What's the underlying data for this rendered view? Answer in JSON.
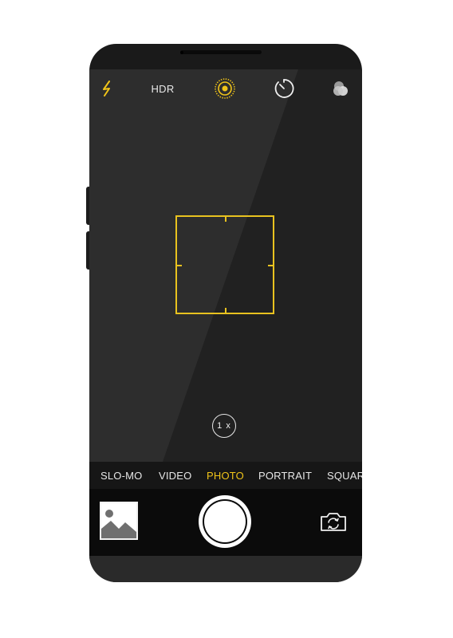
{
  "top_bar": {
    "flash_icon": "lightning-bolt",
    "hdr_label": "HDR",
    "live_photo_icon": "concentric-circles",
    "timer_icon": "timer-dial",
    "filters_icon": "overlapping-circles"
  },
  "zoom": {
    "label": "1 x"
  },
  "modes": [
    {
      "label": "SLO-MO"
    },
    {
      "label": "VIDEO"
    },
    {
      "label": "PHOTO"
    },
    {
      "label": "PORTRAIT"
    },
    {
      "label": "SQUARE"
    }
  ],
  "selected_mode": "PHOTO",
  "colors": {
    "accent": "#f0c419",
    "body": "#1a1a1a",
    "viewfinder": "#1f1f1f",
    "controls": "#0b0b0b"
  }
}
